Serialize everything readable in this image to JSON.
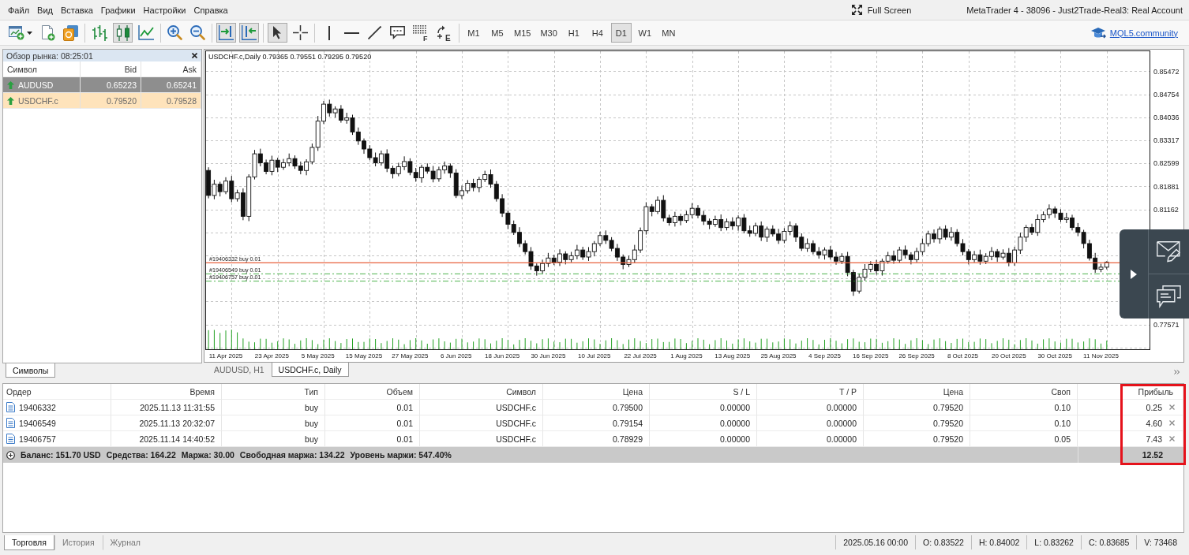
{
  "menu": [
    "Файл",
    "Вид",
    "Вставка",
    "Графики",
    "Настройки",
    "Справка"
  ],
  "title_bar": {
    "fullscreen": "Full Screen",
    "title": "MetaTrader 4 - 38096 - Just2Trade-Real3: Real Account"
  },
  "toolbar": {
    "groups": [
      [
        {
          "kind": "new-chart",
          "selected": false
        },
        {
          "kind": "new-order",
          "selected": false
        },
        {
          "kind": "accounts",
          "selected": false
        }
      ],
      [
        {
          "kind": "bar-chart",
          "selected": false
        },
        {
          "kind": "candlesticks",
          "selected": true
        },
        {
          "kind": "line-chart",
          "selected": false
        }
      ],
      [
        {
          "kind": "zoom-in",
          "selected": false
        },
        {
          "kind": "zoom-out",
          "selected": false
        }
      ],
      [
        {
          "kind": "auto-scroll",
          "selected": true
        },
        {
          "kind": "chart-shift",
          "selected": true
        }
      ],
      [
        {
          "kind": "cursor",
          "selected": true
        },
        {
          "kind": "crosshair",
          "selected": false
        }
      ],
      [
        {
          "kind": "vertical-line",
          "selected": false
        },
        {
          "kind": "horizontal-line",
          "selected": false
        },
        {
          "kind": "trend-line",
          "selected": false
        },
        {
          "kind": "text-label",
          "selected": false
        },
        {
          "kind": "fibonacci",
          "selected": false,
          "glyph": "F"
        },
        {
          "kind": "elliott",
          "selected": false,
          "glyph": "E"
        }
      ]
    ],
    "timeframes": [
      {
        "label": "M1",
        "selected": false
      },
      {
        "label": "M5",
        "selected": false
      },
      {
        "label": "M15",
        "selected": false
      },
      {
        "label": "M30",
        "selected": false
      },
      {
        "label": "H1",
        "selected": false
      },
      {
        "label": "H4",
        "selected": false
      },
      {
        "label": "D1",
        "selected": true
      },
      {
        "label": "W1",
        "selected": false
      },
      {
        "label": "MN",
        "selected": false
      }
    ],
    "community_link": "MQL5.community"
  },
  "market_watch": {
    "title": "Обзор рынка: 08:25:01",
    "columns": [
      "Символ",
      "Bid",
      "Ask"
    ],
    "rows": [
      {
        "symbol": "AUDUSD",
        "bid": "0.65223",
        "ask": "0.65241",
        "rising": true,
        "selected": true,
        "highlighted": false
      },
      {
        "symbol": "USDCHF.c",
        "bid": "0.79520",
        "ask": "0.79528",
        "rising": true,
        "selected": false,
        "highlighted": true
      }
    ],
    "tabs": [
      {
        "label": "Символы",
        "selected": true
      }
    ]
  },
  "chart": {
    "chart_data": {
      "type": "candlestick",
      "title": "USDCHF.c,Daily 0.79365 0.79551 0.79295 0.79520",
      "categories": [
        null,
        null,
        null,
        "11 Apr 2025",
        null,
        null,
        null,
        null,
        null,
        null,
        null,
        "23 Apr 2025",
        null,
        null,
        null,
        null,
        null,
        null,
        null,
        "5 May 2025",
        null,
        null,
        null,
        null,
        null,
        null,
        null,
        "15 May 2025",
        null,
        null,
        null,
        null,
        null,
        null,
        null,
        "27 May 2025",
        null,
        null,
        null,
        null,
        null,
        null,
        null,
        "6 Jun 2025",
        null,
        null,
        null,
        null,
        null,
        null,
        null,
        "18 Jun 2025",
        null,
        null,
        null,
        null,
        null,
        null,
        null,
        "30 Jun 2025",
        null,
        null,
        null,
        null,
        null,
        null,
        null,
        "10 Jul 2025",
        null,
        null,
        null,
        null,
        null,
        null,
        null,
        "22 Jul 2025",
        null,
        null,
        null,
        null,
        null,
        null,
        null,
        "1 Aug 2025",
        null,
        null,
        null,
        null,
        null,
        null,
        null,
        "13 Aug 2025",
        null,
        null,
        null,
        null,
        null,
        null,
        null,
        "25 Aug 2025",
        null,
        null,
        null,
        null,
        null,
        null,
        null,
        "4 Sep 2025",
        null,
        null,
        null,
        null,
        null,
        null,
        null,
        "16 Sep 2025",
        null,
        null,
        null,
        null,
        null,
        null,
        null,
        "26 Sep 2025",
        null,
        null,
        null,
        null,
        null,
        null,
        null,
        "8 Oct 2025",
        null,
        null,
        null,
        null,
        null,
        null,
        null,
        "20 Oct 2025",
        null,
        null,
        null,
        null,
        null,
        null,
        null,
        "30 Oct 2025",
        null,
        null,
        null,
        null,
        null,
        null,
        null,
        "11 Nov 2025",
        null,
        null,
        null,
        null,
        null,
        null,
        null,
        null
      ],
      "ohlc": [
        [
          0.8238,
          0.8248,
          0.8151,
          0.816
        ],
        [
          0.816,
          0.8209,
          0.8148,
          0.8195
        ],
        [
          0.8195,
          0.8203,
          0.8157,
          0.8172
        ],
        [
          0.8172,
          0.8217,
          0.8164,
          0.8205
        ],
        [
          0.8205,
          0.8221,
          0.8139,
          0.815
        ],
        [
          0.815,
          0.8178,
          0.8141,
          0.8168
        ],
        [
          0.8168,
          0.8182,
          0.8083,
          0.8095
        ],
        [
          0.8095,
          0.8226,
          0.808,
          0.8218
        ],
        [
          0.8218,
          0.8302,
          0.821,
          0.829
        ],
        [
          0.829,
          0.8306,
          0.8251,
          0.8262
        ],
        [
          0.8262,
          0.8272,
          0.8226,
          0.8235
        ],
        [
          0.8235,
          0.8284,
          0.8223,
          0.827
        ],
        [
          0.827,
          0.8278,
          0.8233,
          0.8248
        ],
        [
          0.8248,
          0.8274,
          0.824,
          0.8262
        ],
        [
          0.8262,
          0.8291,
          0.8251,
          0.8275
        ],
        [
          0.8275,
          0.8285,
          0.8243,
          0.8252
        ],
        [
          0.8252,
          0.8266,
          0.8226,
          0.8238
        ],
        [
          0.8238,
          0.8273,
          0.8223,
          0.8265
        ],
        [
          0.8265,
          0.8322,
          0.8257,
          0.831
        ],
        [
          0.831,
          0.8408,
          0.8299,
          0.8392
        ],
        [
          0.8392,
          0.8455,
          0.8383,
          0.8445
        ],
        [
          0.8445,
          0.8459,
          0.8406,
          0.8418
        ],
        [
          0.8418,
          0.8438,
          0.8403,
          0.843
        ],
        [
          0.843,
          0.8442,
          0.8387,
          0.8395
        ],
        [
          0.8395,
          0.8418,
          0.8384,
          0.8402
        ],
        [
          0.8402,
          0.8412,
          0.8349,
          0.8358
        ],
        [
          0.8358,
          0.8372,
          0.8318,
          0.833
        ],
        [
          0.833,
          0.8338,
          0.829,
          0.8305
        ],
        [
          0.8305,
          0.8317,
          0.827,
          0.8278
        ],
        [
          0.8278,
          0.8294,
          0.8251,
          0.8262
        ],
        [
          0.8262,
          0.83,
          0.8253,
          0.829
        ],
        [
          0.829,
          0.8304,
          0.8233,
          0.8245
        ],
        [
          0.8245,
          0.8253,
          0.8213,
          0.8228
        ],
        [
          0.8228,
          0.8262,
          0.822,
          0.825
        ],
        [
          0.825,
          0.8282,
          0.8239,
          0.8266
        ],
        [
          0.8266,
          0.8276,
          0.8223,
          0.8232
        ],
        [
          0.8232,
          0.8246,
          0.8203,
          0.8215
        ],
        [
          0.8215,
          0.8256,
          0.82,
          0.8248
        ],
        [
          0.8248,
          0.826,
          0.8228,
          0.8236
        ],
        [
          0.8236,
          0.8252,
          0.8201,
          0.8212
        ],
        [
          0.8212,
          0.825,
          0.8203,
          0.824
        ],
        [
          0.824,
          0.8266,
          0.8228,
          0.8252
        ],
        [
          0.8252,
          0.826,
          0.8215,
          0.823
        ],
        [
          0.823,
          0.8242,
          0.8152,
          0.816
        ],
        [
          0.816,
          0.8191,
          0.8149,
          0.8175
        ],
        [
          0.8175,
          0.8208,
          0.8166,
          0.8198
        ],
        [
          0.8198,
          0.8212,
          0.8173,
          0.8185
        ],
        [
          0.8185,
          0.8218,
          0.817,
          0.821
        ],
        [
          0.821,
          0.8237,
          0.8202,
          0.8225
        ],
        [
          0.8225,
          0.8241,
          0.8184,
          0.8195
        ],
        [
          0.8195,
          0.8205,
          0.8141,
          0.815
        ],
        [
          0.815,
          0.8164,
          0.8093,
          0.8105
        ],
        [
          0.8105,
          0.8113,
          0.8055,
          0.807
        ],
        [
          0.807,
          0.8082,
          0.8037,
          0.8045
        ],
        [
          0.8045,
          0.8061,
          0.7999,
          0.801
        ],
        [
          0.801,
          0.802,
          0.7976,
          0.7985
        ],
        [
          0.7985,
          0.7999,
          0.7928,
          0.794
        ],
        [
          0.794,
          0.7948,
          0.791,
          0.7925
        ],
        [
          0.7925,
          0.796,
          0.7917,
          0.7948
        ],
        [
          0.7948,
          0.7981,
          0.7937,
          0.7965
        ],
        [
          0.7965,
          0.7975,
          0.7943,
          0.7952
        ],
        [
          0.7952,
          0.7992,
          0.794,
          0.7978
        ],
        [
          0.7978,
          0.7986,
          0.7945,
          0.796
        ],
        [
          0.796,
          0.7984,
          0.7952,
          0.7972
        ],
        [
          0.7972,
          0.8006,
          0.7961,
          0.799
        ],
        [
          0.799,
          0.8,
          0.7959,
          0.7968
        ],
        [
          0.7968,
          0.7999,
          0.7956,
          0.7985
        ],
        [
          0.7985,
          0.8018,
          0.797,
          0.801
        ],
        [
          0.801,
          0.8047,
          0.8002,
          0.8035
        ],
        [
          0.8035,
          0.8051,
          0.8009,
          0.802
        ],
        [
          0.802,
          0.803,
          0.7986,
          0.7995
        ],
        [
          0.7995,
          0.8009,
          0.7956,
          0.7968
        ],
        [
          0.7968,
          0.7976,
          0.793,
          0.7945
        ],
        [
          0.7945,
          0.7972,
          0.7937,
          0.796
        ],
        [
          0.796,
          0.8006,
          0.7949,
          0.799
        ],
        [
          0.799,
          0.806,
          0.7981,
          0.805
        ],
        [
          0.805,
          0.8139,
          0.8038,
          0.8125
        ],
        [
          0.8125,
          0.8133,
          0.8095,
          0.811
        ],
        [
          0.811,
          0.8157,
          0.8102,
          0.8145
        ],
        [
          0.8145,
          0.8161,
          0.8079,
          0.809
        ],
        [
          0.809,
          0.81,
          0.8066,
          0.8075
        ],
        [
          0.8075,
          0.8109,
          0.8063,
          0.8095
        ],
        [
          0.8095,
          0.8103,
          0.8067,
          0.8082
        ],
        [
          0.8082,
          0.8112,
          0.8074,
          0.81
        ],
        [
          0.81,
          0.8136,
          0.8089,
          0.812
        ],
        [
          0.812,
          0.813,
          0.8089,
          0.8098
        ],
        [
          0.8098,
          0.8112,
          0.8068,
          0.808
        ],
        [
          0.808,
          0.8088,
          0.8055,
          0.807
        ],
        [
          0.807,
          0.8097,
          0.8062,
          0.8085
        ],
        [
          0.8085,
          0.8101,
          0.8049,
          0.806
        ],
        [
          0.806,
          0.8088,
          0.8051,
          0.8078
        ],
        [
          0.8078,
          0.8092,
          0.8053,
          0.8065
        ],
        [
          0.8065,
          0.8098,
          0.805,
          0.809
        ],
        [
          0.809,
          0.8102,
          0.8042,
          0.805
        ],
        [
          0.805,
          0.8066,
          0.8031,
          0.8042
        ],
        [
          0.8042,
          0.8075,
          0.8033,
          0.8065
        ],
        [
          0.8065,
          0.8079,
          0.8018,
          0.803
        ],
        [
          0.803,
          0.8063,
          0.8015,
          0.8055
        ],
        [
          0.8055,
          0.8067,
          0.8032,
          0.804
        ],
        [
          0.804,
          0.8056,
          0.8009,
          0.802
        ],
        [
          0.802,
          0.8058,
          0.8011,
          0.8048
        ],
        [
          0.8048,
          0.8079,
          0.8036,
          0.8065
        ],
        [
          0.8065,
          0.8073,
          0.8015,
          0.803
        ],
        [
          0.803,
          0.8042,
          0.7987,
          0.7995
        ],
        [
          0.7995,
          0.8026,
          0.7984,
          0.801
        ],
        [
          0.801,
          0.802,
          0.7976,
          0.7985
        ],
        [
          0.7985,
          0.7999,
          0.7963,
          0.7975
        ],
        [
          0.7975,
          0.7998,
          0.796,
          0.799
        ],
        [
          0.799,
          0.8002,
          0.796,
          0.7968
        ],
        [
          0.7968,
          0.7984,
          0.7944,
          0.7955
        ],
        [
          0.7955,
          0.798,
          0.7946,
          0.797
        ],
        [
          0.797,
          0.7984,
          0.7908,
          0.792
        ],
        [
          0.792,
          0.7928,
          0.7847,
          0.7862
        ],
        [
          0.7862,
          0.7917,
          0.7854,
          0.7905
        ],
        [
          0.7905,
          0.7946,
          0.7894,
          0.793
        ],
        [
          0.793,
          0.7955,
          0.7921,
          0.7945
        ],
        [
          0.7945,
          0.7959,
          0.7913,
          0.7925
        ],
        [
          0.7925,
          0.7963,
          0.791,
          0.7955
        ],
        [
          0.7955,
          0.7984,
          0.7947,
          0.7972
        ],
        [
          0.7972,
          0.7988,
          0.7947,
          0.7958
        ],
        [
          0.7958,
          0.8,
          0.7949,
          0.799
        ],
        [
          0.799,
          0.8004,
          0.7963,
          0.7975
        ],
        [
          0.7975,
          0.7983,
          0.7945,
          0.796
        ],
        [
          0.796,
          0.7997,
          0.7952,
          0.7985
        ],
        [
          0.7985,
          0.8026,
          0.7974,
          0.801
        ],
        [
          0.801,
          0.805,
          0.8001,
          0.804
        ],
        [
          0.804,
          0.8054,
          0.8013,
          0.8025
        ],
        [
          0.8025,
          0.8063,
          0.801,
          0.8055
        ],
        [
          0.8055,
          0.8067,
          0.8022,
          0.803
        ],
        [
          0.803,
          0.8061,
          0.8019,
          0.8045
        ],
        [
          0.8045,
          0.8055,
          0.8001,
          0.801
        ],
        [
          0.801,
          0.8024,
          0.7973,
          0.7985
        ],
        [
          0.7985,
          0.7993,
          0.7945,
          0.796
        ],
        [
          0.796,
          0.7987,
          0.7952,
          0.7975
        ],
        [
          0.7975,
          0.7991,
          0.7944,
          0.7955
        ],
        [
          0.7955,
          0.798,
          0.7946,
          0.797
        ],
        [
          0.797,
          0.7999,
          0.7958,
          0.7985
        ],
        [
          0.7985,
          0.7993,
          0.7953,
          0.7968
        ],
        [
          0.7968,
          0.7992,
          0.796,
          0.798
        ],
        [
          0.798,
          0.7996,
          0.7939,
          0.795
        ],
        [
          0.795,
          0.8,
          0.7941,
          0.799
        ],
        [
          0.799,
          0.8044,
          0.7978,
          0.803
        ],
        [
          0.803,
          0.8068,
          0.8015,
          0.806
        ],
        [
          0.806,
          0.8072,
          0.8037,
          0.8045
        ],
        [
          0.8045,
          0.8101,
          0.8034,
          0.8085
        ],
        [
          0.8085,
          0.811,
          0.8076,
          0.81
        ],
        [
          0.81,
          0.8132,
          0.8088,
          0.8118
        ],
        [
          0.8118,
          0.8126,
          0.809,
          0.8105
        ],
        [
          0.8105,
          0.8117,
          0.8077,
          0.8085
        ],
        [
          0.8085,
          0.8106,
          0.8074,
          0.809
        ],
        [
          0.809,
          0.81,
          0.8051,
          0.806
        ],
        [
          0.806,
          0.8074,
          0.8033,
          0.8045
        ],
        [
          0.8045,
          0.8053,
          0.7995,
          0.801
        ],
        [
          0.801,
          0.8022,
          0.7957,
          0.7965
        ],
        [
          0.7965,
          0.7981,
          0.7919,
          0.793
        ],
        [
          0.793,
          0.7947,
          0.7921,
          0.79365
        ],
        [
          0.79365,
          0.79551,
          0.79295,
          0.7952
        ],
        null,
        null,
        null,
        null,
        null,
        null,
        null
      ],
      "ylim": [
        0.76792,
        0.86111
      ],
      "yticks": [
        0.85472,
        0.84754,
        0.84036,
        0.83317,
        0.82599,
        0.81881,
        0.81162,
        0.77571
      ],
      "grid": true,
      "ref_lines": [
        {
          "axis": "y",
          "value": 0.795,
          "label": "#19406332 buy 0.01",
          "color": "#e8603c"
        },
        {
          "axis": "y",
          "value": 0.79154,
          "label": "#19406549 buy 0.01",
          "color": "#1fa01f"
        },
        {
          "axis": "y",
          "value": 0.78929,
          "label": "#19406757 buy 0.01",
          "color": "#1fa01f"
        }
      ]
    },
    "tabs": [
      {
        "label": "AUDUSD, H1",
        "selected": false
      },
      {
        "label": "USDCHF.c, Daily",
        "selected": true
      }
    ]
  },
  "trade": {
    "columns": [
      "Ордер",
      "Время",
      "Тип",
      "Объем",
      "Символ",
      "Цена",
      "S / L",
      "T / P",
      "Цена",
      "Своп",
      "Прибыль"
    ],
    "rows": [
      [
        "19406332",
        "2025.11.13 11:31:55",
        "buy",
        "0.01",
        "USDCHF.c",
        "0.79500",
        "0.00000",
        "0.00000",
        "0.79520",
        "0.10",
        "0.25"
      ],
      [
        "19406549",
        "2025.11.13 20:32:07",
        "buy",
        "0.01",
        "USDCHF.c",
        "0.79154",
        "0.00000",
        "0.00000",
        "0.79520",
        "0.10",
        "4.60"
      ],
      [
        "19406757",
        "2025.11.14 14:40:52",
        "buy",
        "0.01",
        "USDCHF.c",
        "0.78929",
        "0.00000",
        "0.00000",
        "0.79520",
        "0.05",
        "7.43"
      ]
    ],
    "summary": [
      "Баланс: 151.70 USD",
      "Средства: 164.22",
      "Маржа: 30.00",
      "Свободная маржа: 134.22",
      "Уровень маржи: 547.40%"
    ],
    "total_profit": "12.52",
    "profit_highlighted": true
  },
  "terminal_tabs": [
    {
      "label": "Торговля",
      "selected": true
    },
    {
      "label": "История",
      "selected": false
    },
    {
      "label": "Журнал",
      "selected": false
    }
  ],
  "status_bar": [
    "2025.05.16 00:00",
    "O: 0.83522",
    "H: 0.84002",
    "L: 0.83262",
    "C: 0.83685",
    "V: 73468"
  ]
}
